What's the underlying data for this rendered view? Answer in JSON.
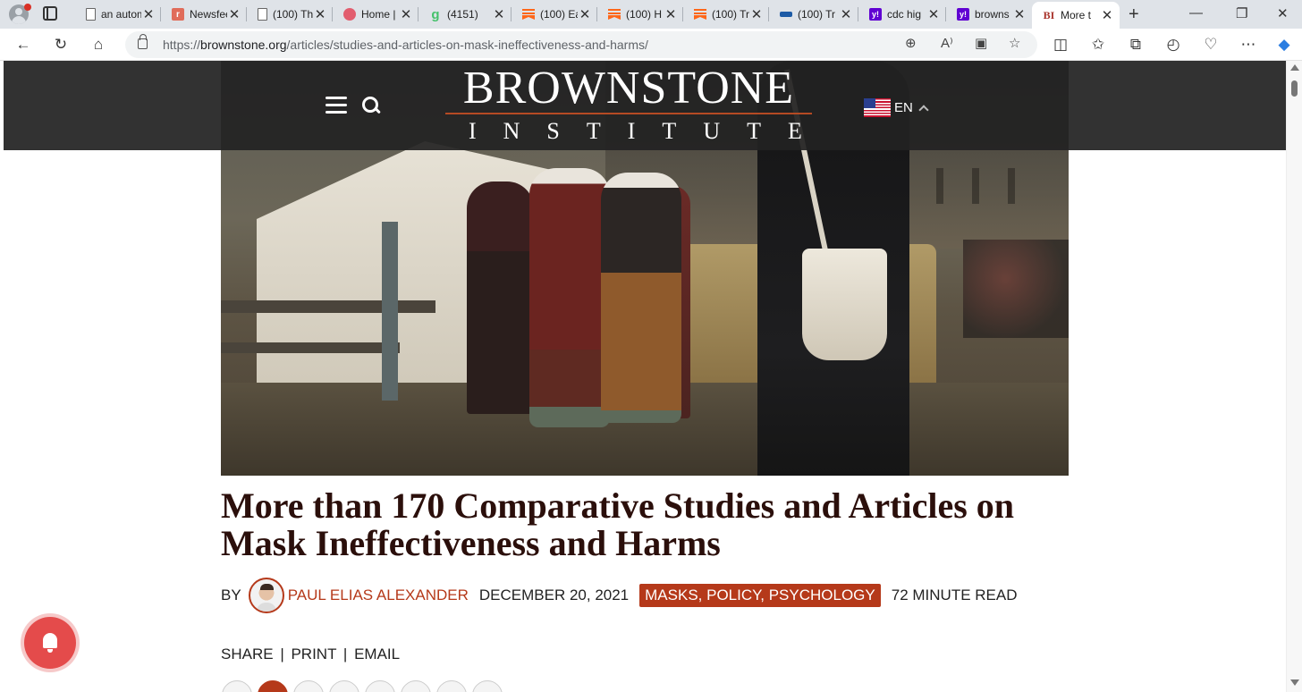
{
  "browser": {
    "tabs": [
      {
        "title": "an autom",
        "favicon": "doc-icon"
      },
      {
        "title": "Newsfeed",
        "favicon": "t-logo-icon"
      },
      {
        "title": "(100) Th",
        "favicon": "doc-icon"
      },
      {
        "title": "Home |",
        "favicon": "home-logo-icon"
      },
      {
        "title": "(4151)",
        "favicon": "g-logo-icon"
      },
      {
        "title": "(100) Ea",
        "favicon": "substack-icon"
      },
      {
        "title": "(100) H",
        "favicon": "substack-icon"
      },
      {
        "title": "(100) Tr",
        "favicon": "substack-icon"
      },
      {
        "title": "(100) Tr",
        "favicon": "cdc-icon"
      },
      {
        "title": "cdc hig",
        "favicon": "yahoo-icon"
      },
      {
        "title": "browns",
        "favicon": "yahoo-icon"
      },
      {
        "title": "More t",
        "favicon": "brownstone-icon",
        "active": true
      }
    ],
    "close_glyph": "✕",
    "new_tab_glyph": "+",
    "url_prefix": "https://",
    "url_host": "brownstone.org",
    "url_path": "/articles/studies-and-articles-on-mask-ineffectiveness-and-harms/"
  },
  "site": {
    "logo_main": "BROWNSTONE",
    "logo_sub": "INSTITUTE",
    "language": "EN"
  },
  "article": {
    "title": "More than 170 Comparative Studies and Articles on Mask Ineffectiveness and Harms",
    "by_label": "BY",
    "author": "PAUL ELIAS ALEXANDER",
    "date": "DECEMBER 20, 2021",
    "tags": "MASKS, POLICY, PSYCHOLOGY",
    "read_time": "72 MINUTE READ",
    "share": "SHARE",
    "print": "PRINT",
    "email": "EMAIL",
    "separator": "|"
  },
  "colors": {
    "accent": "#b5391a",
    "title": "#2b0f0b",
    "header_bg": "#222222",
    "bell": "#e44b4b"
  }
}
